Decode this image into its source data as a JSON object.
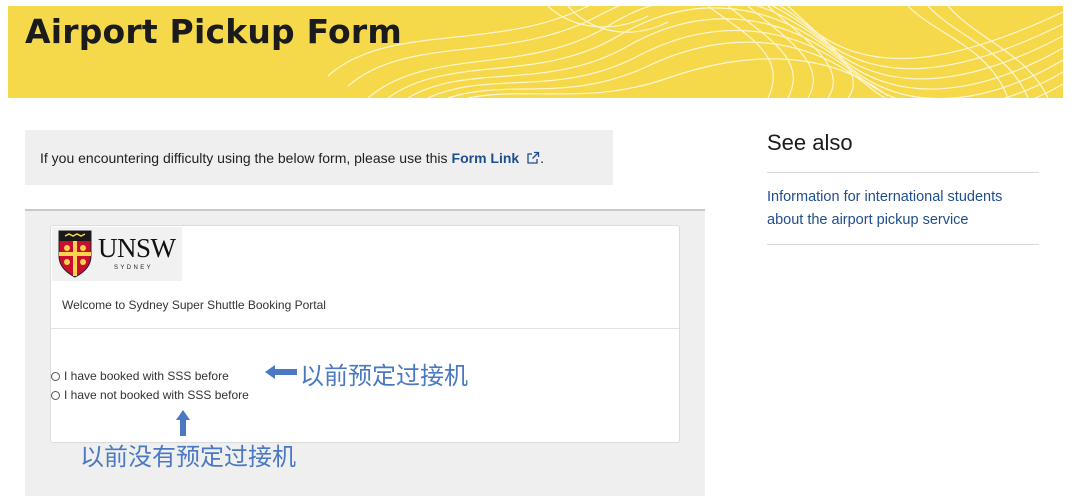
{
  "header": {
    "title": "Airport Pickup Form"
  },
  "notice": {
    "text": "If you encountering difficulty using the below form, please use this",
    "link_label": "Form Link",
    "suffix": ".",
    "icon": "external-link-icon"
  },
  "embedded_portal": {
    "logo_text": "UNSW",
    "logo_subtext": "SYDNEY",
    "welcome": "Welcome to Sydney Super Shuttle Booking Portal",
    "options": [
      {
        "label": "I have booked with SSS before",
        "checked": false
      },
      {
        "label": "I have not booked with SSS before",
        "checked": false
      }
    ]
  },
  "annotations": {
    "booked_before": "以前预定过接机",
    "not_booked_before": "以前没有预定过接机",
    "color": "#4a78c2"
  },
  "sidebar": {
    "heading": "See also",
    "link": "Information for international students about the airport pickup service"
  },
  "colors": {
    "banner": "#f6d94b",
    "link": "#1f4e8c",
    "notice_bg": "#efefef"
  }
}
